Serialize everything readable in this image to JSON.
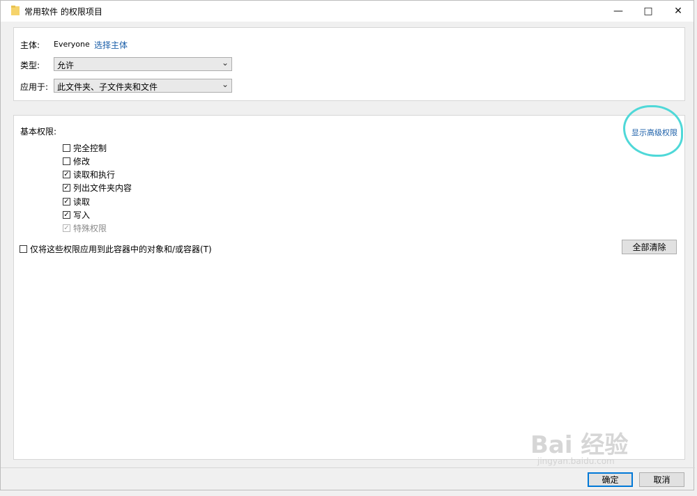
{
  "window": {
    "title": "常用软件 的权限项目"
  },
  "principal": {
    "label": "主体:",
    "value": "Everyone",
    "select_link": "选择主体"
  },
  "type": {
    "label": "类型:",
    "selected": "允许"
  },
  "applies_to": {
    "label": "应用于:",
    "selected": "此文件夹、子文件夹和文件"
  },
  "basic": {
    "header": "基本权限:",
    "show_advanced": "显示高级权限",
    "permissions": [
      {
        "label": "完全控制",
        "checked": false,
        "disabled": false
      },
      {
        "label": "修改",
        "checked": false,
        "disabled": false
      },
      {
        "label": "读取和执行",
        "checked": true,
        "disabled": false
      },
      {
        "label": "列出文件夹内容",
        "checked": true,
        "disabled": false
      },
      {
        "label": "读取",
        "checked": true,
        "disabled": false
      },
      {
        "label": "写入",
        "checked": true,
        "disabled": false
      },
      {
        "label": "特殊权限",
        "checked": true,
        "disabled": true
      }
    ],
    "apply_only_label": "仅将这些权限应用到此容器中的对象和/或容器(T)",
    "clear_all": "全部清除"
  },
  "footer": {
    "ok": "确定",
    "cancel": "取消"
  },
  "watermark": {
    "main": "Bai 经验",
    "sub": "jingyan.baidu.com"
  },
  "colors": {
    "link": "#1a5ea8",
    "highlight": "#4fd8d8",
    "accent": "#0078d7"
  }
}
